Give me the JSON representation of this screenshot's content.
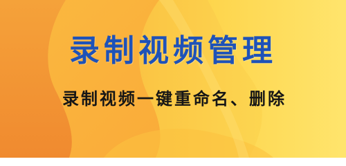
{
  "banner": {
    "title": "录制视频管理",
    "subtitle": "录制视频一键重命名、删除",
    "colors": {
      "title": "#1e52b8",
      "subtitle": "#161616",
      "bg_base": "#fdd84a",
      "bg_orange": "#f6a436",
      "bg_deep_orange": "#f28a2e",
      "bg_light": "#ffe46c"
    }
  }
}
